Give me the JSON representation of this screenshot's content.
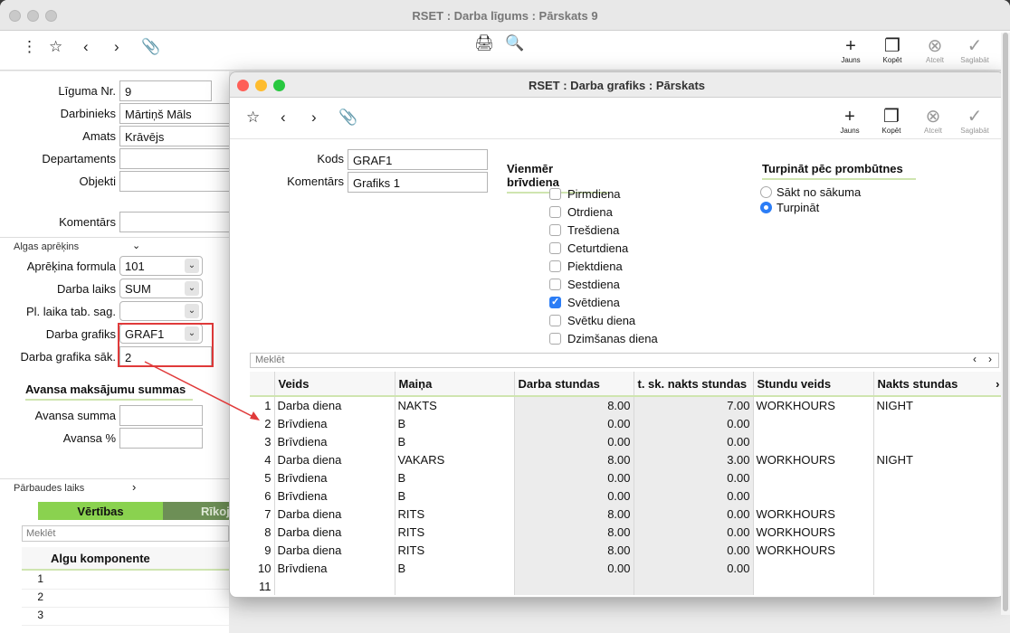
{
  "bg_window": {
    "title": "RSET : Darba līgums : Pārskats 9",
    "toolbar": {
      "new_label": "Jauns",
      "copy_label": "Kopēt",
      "cancel_label": "Atcelt",
      "save_label": "Saglabāt"
    },
    "fields": {
      "contract_no_label": "Līguma Nr.",
      "contract_no": "9",
      "employee_label": "Darbinieks",
      "employee": "Mārtiņš Māls",
      "position_label": "Amats",
      "position": "Krāvējs",
      "department_label": "Departaments",
      "department": "",
      "object_label": "Objekti",
      "object": "",
      "comment_label": "Komentārs",
      "comment": ""
    },
    "salary_section": "Algas aprēķins",
    "salary": {
      "formula_label": "Aprēķina formula",
      "formula": "101",
      "worktime_label": "Darba laiks",
      "worktime": "SUM",
      "pl_label": "Pl. laika tab. sag.",
      "pl": "",
      "schedule_label": "Darba grafiks",
      "schedule": "GRAF1",
      "schedule_start_label": "Darba grafika sāk.",
      "schedule_start": "2"
    },
    "advance_section": "Avansa maksājumu summas",
    "advance": {
      "sum_label": "Avansa summa",
      "sum": "",
      "pct_label": "Avansa %",
      "pct": ""
    },
    "check_label": "Pārbaudes laiks",
    "tabs": [
      "Vērtības",
      "Rīkoj"
    ],
    "search_placeholder": "Meklēt",
    "table_header": "Algu komponente",
    "rows": [
      "1",
      "2",
      "3"
    ]
  },
  "fg_window": {
    "title": "RSET : Darba grafiks : Pārskats",
    "toolbar": {
      "new_label": "Jauns",
      "copy_label": "Kopēt",
      "cancel_label": "Atcelt",
      "save_label": "Saglabāt"
    },
    "code_label": "Kods",
    "code": "GRAF1",
    "comment_label": "Komentārs",
    "comment": "Grafiks 1",
    "always_free_title": "Vienmēr brīvdiena",
    "days": [
      {
        "label": "Pirmdiena",
        "checked": false
      },
      {
        "label": "Otrdiena",
        "checked": false
      },
      {
        "label": "Trešdiena",
        "checked": false
      },
      {
        "label": "Ceturtdiena",
        "checked": false
      },
      {
        "label": "Piektdiena",
        "checked": false
      },
      {
        "label": "Sestdiena",
        "checked": false
      },
      {
        "label": "Svētdiena",
        "checked": true
      },
      {
        "label": "Svētku diena",
        "checked": false
      },
      {
        "label": "Dzimšanas diena",
        "checked": false
      }
    ],
    "continue_title": "Turpināt pēc prombūtnes",
    "continue_options": [
      {
        "label": "Sākt no sākuma",
        "selected": false
      },
      {
        "label": "Turpināt",
        "selected": true
      }
    ],
    "search_placeholder": "Meklēt",
    "columns": [
      "Veids",
      "Maiņa",
      "Darba stundas",
      "t. sk. nakts stundas",
      "Stundu veids",
      "Nakts stundas"
    ],
    "rows": [
      [
        "1",
        "Darba diena",
        "NAKTS",
        "8.00",
        "7.00",
        "WORKHOURS",
        "NIGHT"
      ],
      [
        "2",
        "Brīvdiena",
        "B",
        "0.00",
        "0.00",
        "",
        ""
      ],
      [
        "3",
        "Brīvdiena",
        "B",
        "0.00",
        "0.00",
        "",
        ""
      ],
      [
        "4",
        "Darba diena",
        "VAKARS",
        "8.00",
        "3.00",
        "WORKHOURS",
        "NIGHT"
      ],
      [
        "5",
        "Brīvdiena",
        "B",
        "0.00",
        "0.00",
        "",
        ""
      ],
      [
        "6",
        "Brīvdiena",
        "B",
        "0.00",
        "0.00",
        "",
        ""
      ],
      [
        "7",
        "Darba diena",
        "RITS",
        "8.00",
        "0.00",
        "WORKHOURS",
        ""
      ],
      [
        "8",
        "Darba diena",
        "RITS",
        "8.00",
        "0.00",
        "WORKHOURS",
        ""
      ],
      [
        "9",
        "Darba diena",
        "RITS",
        "8.00",
        "0.00",
        "WORKHOURS",
        ""
      ],
      [
        "10",
        "Brīvdiena",
        "B",
        "0.00",
        "0.00",
        "",
        ""
      ],
      [
        "11",
        "",
        "",
        "",
        "",
        "",
        ""
      ]
    ]
  },
  "colors": {
    "accent_green": "#8ad24f",
    "highlight_red": "#e03a3a",
    "check_blue": "#2b7df6"
  }
}
